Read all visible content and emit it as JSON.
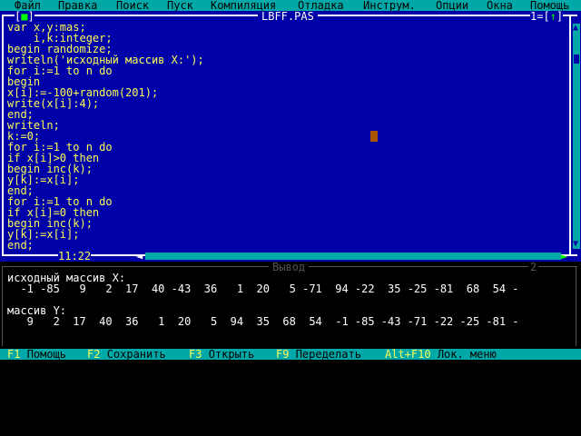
{
  "menu": {
    "items": [
      "Файл",
      "Правка",
      "Поиск",
      "Пуск",
      "Компиляция",
      "Отладка",
      "Инструм.",
      "Опции",
      "Окна",
      "Помощь"
    ]
  },
  "editor": {
    "close_symbol": "[■]",
    "title": "LBFF.PAS",
    "window_number": "1",
    "zoom_symbol": "[↑]",
    "cursor_position": "11:22",
    "code_lines": [
      "var x,y:mas;",
      "    i,k:integer;",
      "begin randomize;",
      "writeln('исходный массив X:');",
      "for i:=1 to n do",
      "begin",
      "x[i]:=-100+random(201);",
      "write(x[i]:4);",
      "end;",
      "writeln;",
      "k:=0;",
      "for i:=1 to n do",
      "if x[i]>0 then",
      "begin inc(k);",
      "y[k]:=x[i];",
      "end;",
      "for i:=1 to n do",
      "if x[i]=0 then",
      "begin inc(k);",
      "y[k]:=x[i];",
      "end;"
    ]
  },
  "output": {
    "title": "Вывод",
    "window_number": "2",
    "lines": [
      "исходный массив X:",
      "  -1 -85   9   2  17  40 -43  36   1  20   5 -71  94 -22  35 -25 -81  68  54 -",
      "",
      "массив Y:",
      "   9   2  17  40  36   1  20   5  94  35  68  54  -1 -85 -43 -71 -22 -25 -81 -"
    ]
  },
  "fkeys": [
    {
      "key": "F1",
      "label": "Помощь"
    },
    {
      "key": "F2",
      "label": "Сохранить"
    },
    {
      "key": "F3",
      "label": "Открыть"
    },
    {
      "key": "F9",
      "label": "Переделать"
    },
    {
      "key": "Alt+F10",
      "label": "Лок. меню"
    }
  ],
  "colors": {
    "editor_bg": "#0000a8",
    "menu_bg": "#00a8a8",
    "code_text": "#fcfc54",
    "output_bg": "#000000"
  }
}
